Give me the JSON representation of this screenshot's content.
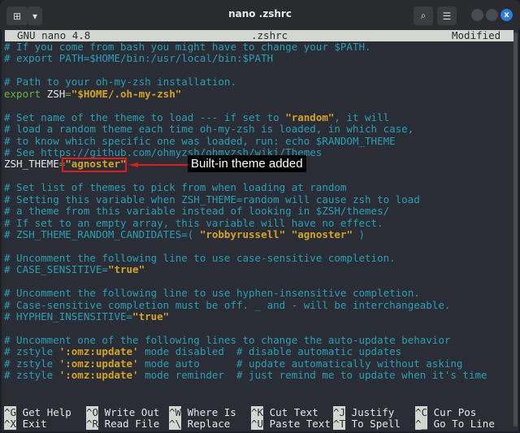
{
  "window": {
    "title": "nano .zshrc",
    "new_tab_icon": "new-tab-icon",
    "menu_icon": "hamburger-icon",
    "search_icon": "search-icon",
    "close_label": "x"
  },
  "nano": {
    "version": "GNU nano 4.8",
    "filename": ".zshrc",
    "status": "Modified"
  },
  "lines": [
    [
      [
        "c",
        "# If you come from bash you might have to change your $PATH."
      ]
    ],
    [
      [
        "c",
        "# export PATH=$HOME/bin:/usr/local/bin:$PATH"
      ]
    ],
    [],
    [
      [
        "c",
        "# Path to your oh-my-zsh installation."
      ]
    ],
    [
      [
        "k",
        "export"
      ],
      [
        "p",
        " ZSH"
      ],
      [
        "k",
        "="
      ],
      [
        "s",
        "\"$HOME/.oh-my-zsh\""
      ]
    ],
    [],
    [
      [
        "c",
        "# Set name of the theme to load --- if set to "
      ],
      [
        "s",
        "\"random\""
      ],
      [
        "c",
        ", it will"
      ]
    ],
    [
      [
        "c",
        "# load a random theme each time oh-my-zsh is loaded, in which case,"
      ]
    ],
    [
      [
        "c",
        "# to know which specific one was loaded, run: echo $RANDOM_THEME"
      ]
    ],
    [
      [
        "c",
        "# See https://github.com/ohmyzsh/ohmyzsh/wiki/Themes"
      ]
    ],
    [
      [
        "p",
        "ZSH_THEME"
      ],
      [
        "k",
        "="
      ],
      [
        "s",
        "\"agnoster\""
      ]
    ],
    [],
    [
      [
        "c",
        "# Set list of themes to pick from when loading at random"
      ]
    ],
    [
      [
        "c",
        "# Setting this variable when ZSH_THEME=random will cause zsh to load"
      ]
    ],
    [
      [
        "c",
        "# a theme from this variable instead of looking in $ZSH/themes/"
      ]
    ],
    [
      [
        "c",
        "# If set to an empty array, this variable will have no effect."
      ]
    ],
    [
      [
        "c",
        "# ZSH_THEME_RANDOM_CANDIDATES=( "
      ],
      [
        "s",
        "\"robbyrussell\""
      ],
      [
        "c",
        " "
      ],
      [
        "s",
        "\"agnoster\""
      ],
      [
        "c",
        " )"
      ]
    ],
    [],
    [
      [
        "c",
        "# Uncomment the following line to use case-sensitive completion."
      ]
    ],
    [
      [
        "c",
        "# CASE_SENSITIVE="
      ],
      [
        "s",
        "\"true\""
      ]
    ],
    [],
    [
      [
        "c",
        "# Uncomment the following line to use hyphen-insensitive completion."
      ]
    ],
    [
      [
        "c",
        "# Case-sensitive completion must be off. _ and - will be interchangeable."
      ]
    ],
    [
      [
        "c",
        "# HYPHEN_INSENSITIVE="
      ],
      [
        "s",
        "\"true\""
      ]
    ],
    [],
    [
      [
        "c",
        "# Uncomment one of the following lines to change the auto-update behavior"
      ]
    ],
    [
      [
        "c",
        "# zstyle "
      ],
      [
        "s",
        "':omz:update'"
      ],
      [
        "c",
        " mode disabled  # disable automatic updates"
      ]
    ],
    [
      [
        "c",
        "# zstyle "
      ],
      [
        "s",
        "':omz:update'"
      ],
      [
        "c",
        " mode auto      # update automatically without asking"
      ]
    ],
    [
      [
        "c",
        "# zstyle "
      ],
      [
        "s",
        "':omz:update'"
      ],
      [
        "c",
        " mode reminder  # just remind me to update when it's time"
      ]
    ]
  ],
  "shortcuts": [
    [
      {
        "key": "^G",
        "label": "Get Help"
      },
      {
        "key": "^O",
        "label": "Write Out"
      },
      {
        "key": "^W",
        "label": "Where Is"
      },
      {
        "key": "^K",
        "label": "Cut Text"
      },
      {
        "key": "^J",
        "label": "Justify"
      },
      {
        "key": "^C",
        "label": "Cur Pos"
      }
    ],
    [
      {
        "key": "^X",
        "label": "Exit"
      },
      {
        "key": "^R",
        "label": "Read File"
      },
      {
        "key": "^\\",
        "label": "Replace"
      },
      {
        "key": "^U",
        "label": "Paste Text"
      },
      {
        "key": "^T",
        "label": "To Spell"
      },
      {
        "key": "^_",
        "label": "Go To Line"
      }
    ]
  ],
  "annotation": {
    "label": "Built-in theme added",
    "color": "#e01b1b"
  }
}
